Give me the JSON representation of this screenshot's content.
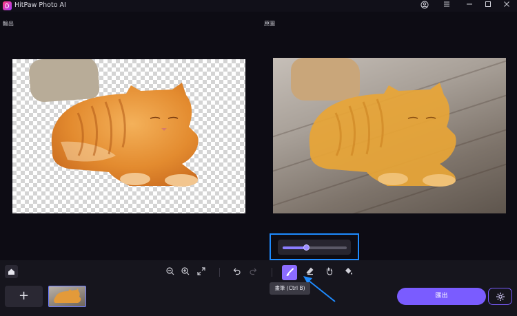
{
  "app": {
    "title": "HitPaw Photo AI"
  },
  "window": {
    "account_icon": "user-circle-icon",
    "menu_icon": "menu-icon",
    "minimize_icon": "minimize-icon",
    "maximize_icon": "maximize-icon",
    "close_icon": "close-icon"
  },
  "panels": {
    "output_label": "輸出",
    "original_label": "原圖"
  },
  "brush": {
    "size_level_percent": 37,
    "highlight_color": "#1e8bff"
  },
  "toolbar": {
    "home_icon": "home-icon",
    "zoom_out_icon": "zoom-out-icon",
    "zoom_in_icon": "zoom-in-icon",
    "fit_icon": "fit-screen-icon",
    "undo_icon": "undo-icon",
    "redo_icon": "redo-icon",
    "brush_icon": "brush-icon",
    "eraser_icon": "eraser-icon",
    "hand_icon": "hand-icon",
    "fill_icon": "paint-bucket-icon",
    "brush_tooltip": "畫筆 (Ctrl B)"
  },
  "bottom": {
    "add_label": "+",
    "export_label": "匯出",
    "settings_icon": "gear-icon"
  },
  "colors": {
    "accent": "#7a5cff",
    "active_tool": "#8b6cff"
  }
}
